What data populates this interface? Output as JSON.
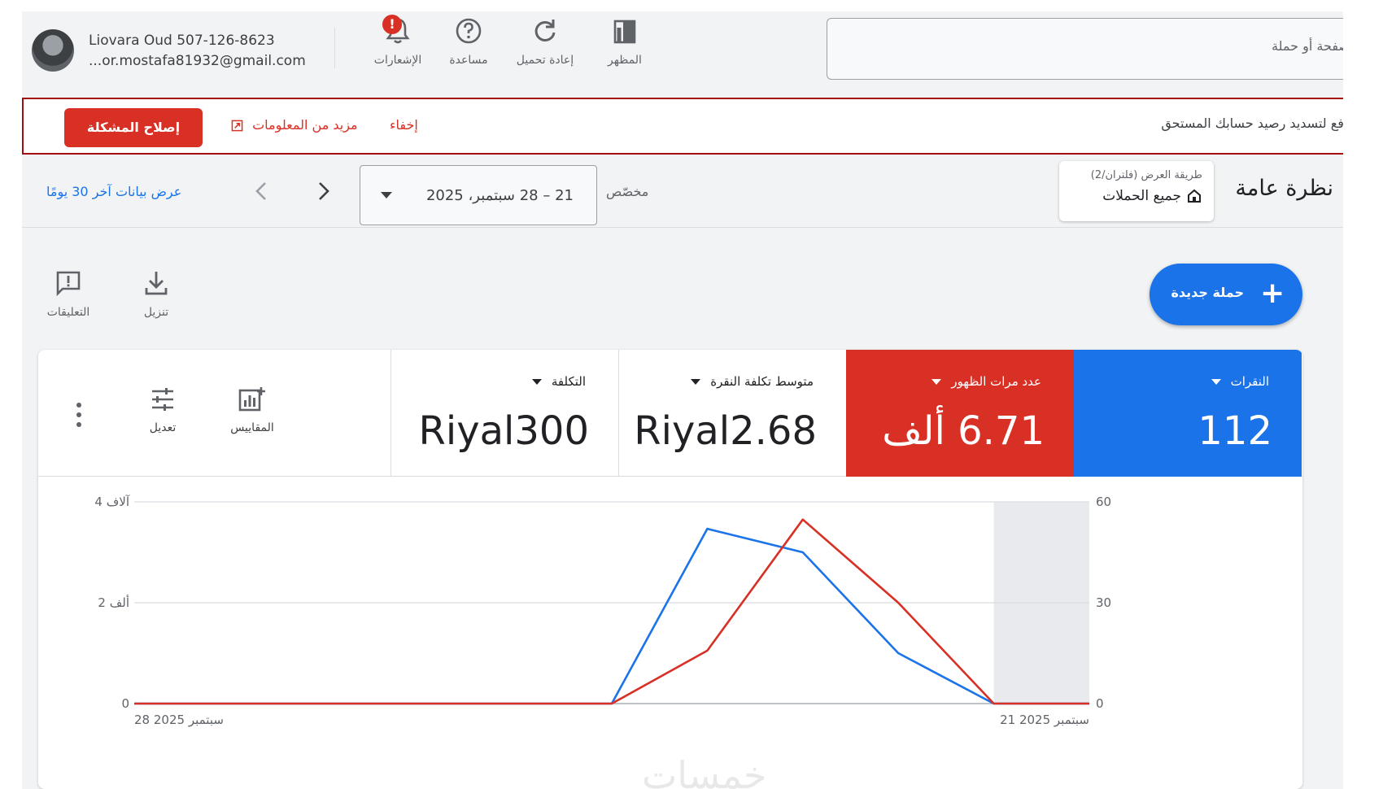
{
  "account": {
    "name": "Liovara Oud 507-126-8623",
    "email": "...or.mostafa81932@gmail.com"
  },
  "toolbar": {
    "notifications_label": "الإشعارات",
    "notifications_badge": "!",
    "help_label": "مساعدة",
    "reload_label": "إعادة تحميل",
    "appearance_label": "المظهر"
  },
  "search": {
    "placeholder": "صفحة أو حملة"
  },
  "alert": {
    "message": ".فع لتسديد رصيد حسابك المستحق",
    "hide_label": "إخفاء",
    "more_info_label": "مزيد من المعلومات",
    "fix_label": "إصلاح المشكلة"
  },
  "overview": {
    "title": "نظرة عامة",
    "view_label": "طريقة العرض (فلتران/2)",
    "view_value": "جميع الحملات",
    "range_type": "مخصّص",
    "date_range": "21 – 28 سبتمبر، 2025",
    "last30_label": "عرض بيانات آخر 30 يومًا"
  },
  "actions": {
    "download_label": "تنزيل",
    "feedback_label": "التعليقات",
    "new_campaign_label": "حملة جديدة"
  },
  "metrics": {
    "clicks": {
      "label": "النقرات",
      "value": "112"
    },
    "impressions": {
      "label": "عدد مرات الظهور",
      "value": "6.71 ألف"
    },
    "avg_cpc": {
      "label": "متوسط تكلفة النقرة",
      "value": "Riyal2.68"
    },
    "cost": {
      "label": "التكلفة",
      "value": "Riyal300"
    },
    "metrics_label": "المقاييس",
    "adjust_label": "تعديل"
  },
  "colors": {
    "clicks": "#1a73e8",
    "impressions": "#d93025"
  },
  "watermark": "خمسات",
  "chart_data": {
    "type": "line",
    "x_labels": [
      "28 سبتمبر 2025",
      "21 سبتمبر 2025"
    ],
    "x": [
      0,
      1,
      2,
      3,
      4,
      5,
      6,
      7,
      8,
      9,
      10
    ],
    "y_left_ticks": [
      "4 آلاف",
      "2 ألف",
      "0"
    ],
    "y_left_range": [
      0,
      4000
    ],
    "y_right_ticks": [
      "60",
      "30",
      "0"
    ],
    "y_right_range": [
      0,
      60
    ],
    "shaded_range": [
      0,
      1
    ],
    "grid": true,
    "series": [
      {
        "axis": "right",
        "color": "#1a73e8",
        "values": [
          0,
          0,
          15,
          45,
          52,
          0,
          0,
          0,
          0,
          0,
          0
        ]
      },
      {
        "axis": "left",
        "color": "#d93025",
        "values": [
          0,
          0,
          2000,
          3650,
          1050,
          0,
          0,
          0,
          0,
          0,
          0
        ]
      }
    ]
  }
}
